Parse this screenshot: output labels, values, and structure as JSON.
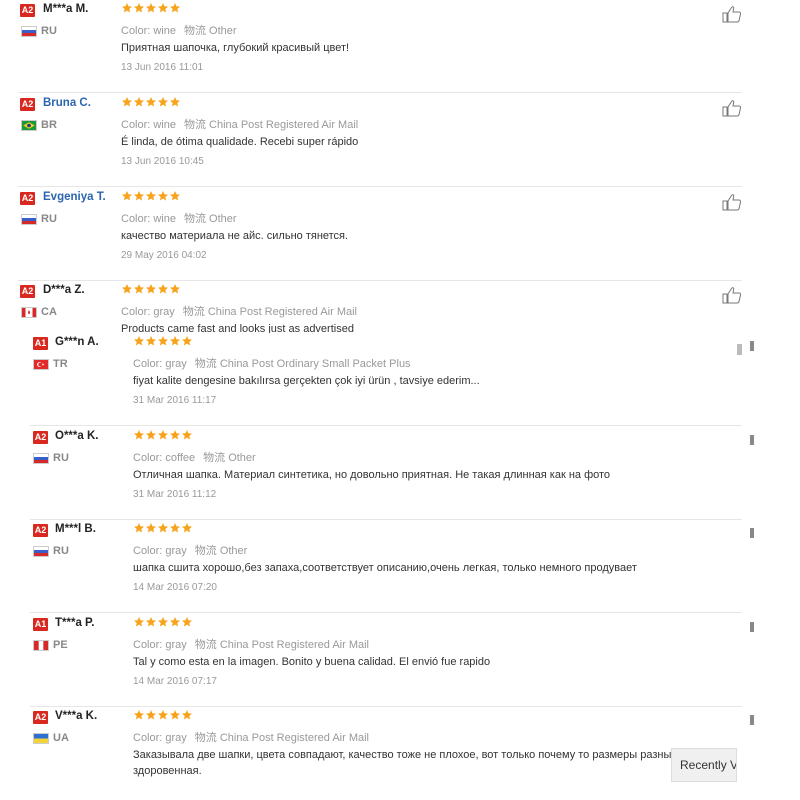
{
  "labels": {
    "color": "Color:",
    "shipping": "物流"
  },
  "colors": {
    "badge": "#d8281f",
    "star": "#f7a31c",
    "link": "#2a65b0"
  },
  "reviews": [
    {
      "badge": "A2",
      "name": "M***a M.",
      "country": "RU",
      "flag": "ru-flag-icon",
      "color": "wine",
      "shipping": "Other",
      "feedback": "Приятная шапочка, глубокий красивый цвет!",
      "date": "13 Jun 2016 11:01",
      "stars": 5
    },
    {
      "badge": "A2",
      "name": "Bruna C.",
      "country": "BR",
      "flag": "br-flag-icon",
      "color": "wine",
      "shipping": "China Post Registered Air Mail",
      "feedback": "É linda, de ótima qualidade. Recebi super rápido",
      "date": "13 Jun 2016 10:45",
      "stars": 5
    },
    {
      "badge": "A2",
      "name": "Evgeniya T.",
      "country": "RU",
      "flag": "ru-flag-icon",
      "color": "wine",
      "shipping": "Other",
      "feedback": "качество материала не айс. сильно тянется.",
      "date": "29 May 2016 04:02",
      "stars": 5
    },
    {
      "badge": "A2",
      "name": "D***a Z.",
      "country": "CA",
      "flag": "ca-flag-icon",
      "color": "gray",
      "shipping": "China Post Registered Air Mail",
      "feedback": "Products came fast and looks just as advertised",
      "date": "",
      "stars": 5
    },
    {
      "badge": "A1",
      "name": "G***n A.",
      "country": "TR",
      "flag": "tr-flag-icon",
      "color": "gray",
      "shipping": "China Post Ordinary Small Packet Plus",
      "feedback": "fiyat kalite dengesine bakılırsa gerçekten çok iyi ürün , tavsiye ederim...",
      "date": "31 Mar 2016 11:17",
      "stars": 5
    },
    {
      "badge": "A2",
      "name": "O***a K.",
      "country": "RU",
      "flag": "ru-flag-icon",
      "color": "coffee",
      "shipping": "Other",
      "feedback": "Отличная шапка. Материал синтетика, но довольно приятная. Не такая длинная как на фото",
      "date": "31 Mar 2016 11:12",
      "stars": 5
    },
    {
      "badge": "A2",
      "name": "M***l B.",
      "country": "RU",
      "flag": "ru-flag-icon",
      "color": "gray",
      "shipping": "Other",
      "feedback": "шапка сшита хорошо,без запаха,соответствует описанию,очень легкая, только немного продувает",
      "date": "14 Mar 2016 07:20",
      "stars": 5
    },
    {
      "badge": "A1",
      "name": "T***a P.",
      "country": "PE",
      "flag": "pe-flag-icon",
      "color": "gray",
      "shipping": "China Post Registered Air Mail",
      "feedback": "Tal y como esta en la imagen. Bonito y buena calidad. El envió fue rapido",
      "date": "14 Mar 2016 07:17",
      "stars": 5
    },
    {
      "badge": "A2",
      "name": "V***a K.",
      "country": "UA",
      "flag": "ua-flag-icon",
      "color": "gray",
      "shipping": "China Post Registered Air Mail",
      "feedback": "Заказывала две шапки, цвета совпадают, качество тоже не плохое, вот только почему то размеры разные.",
      "feedback2": "здоровенная.",
      "date": "",
      "stars": 5
    }
  ],
  "recently_viewed": "Recently Vi"
}
